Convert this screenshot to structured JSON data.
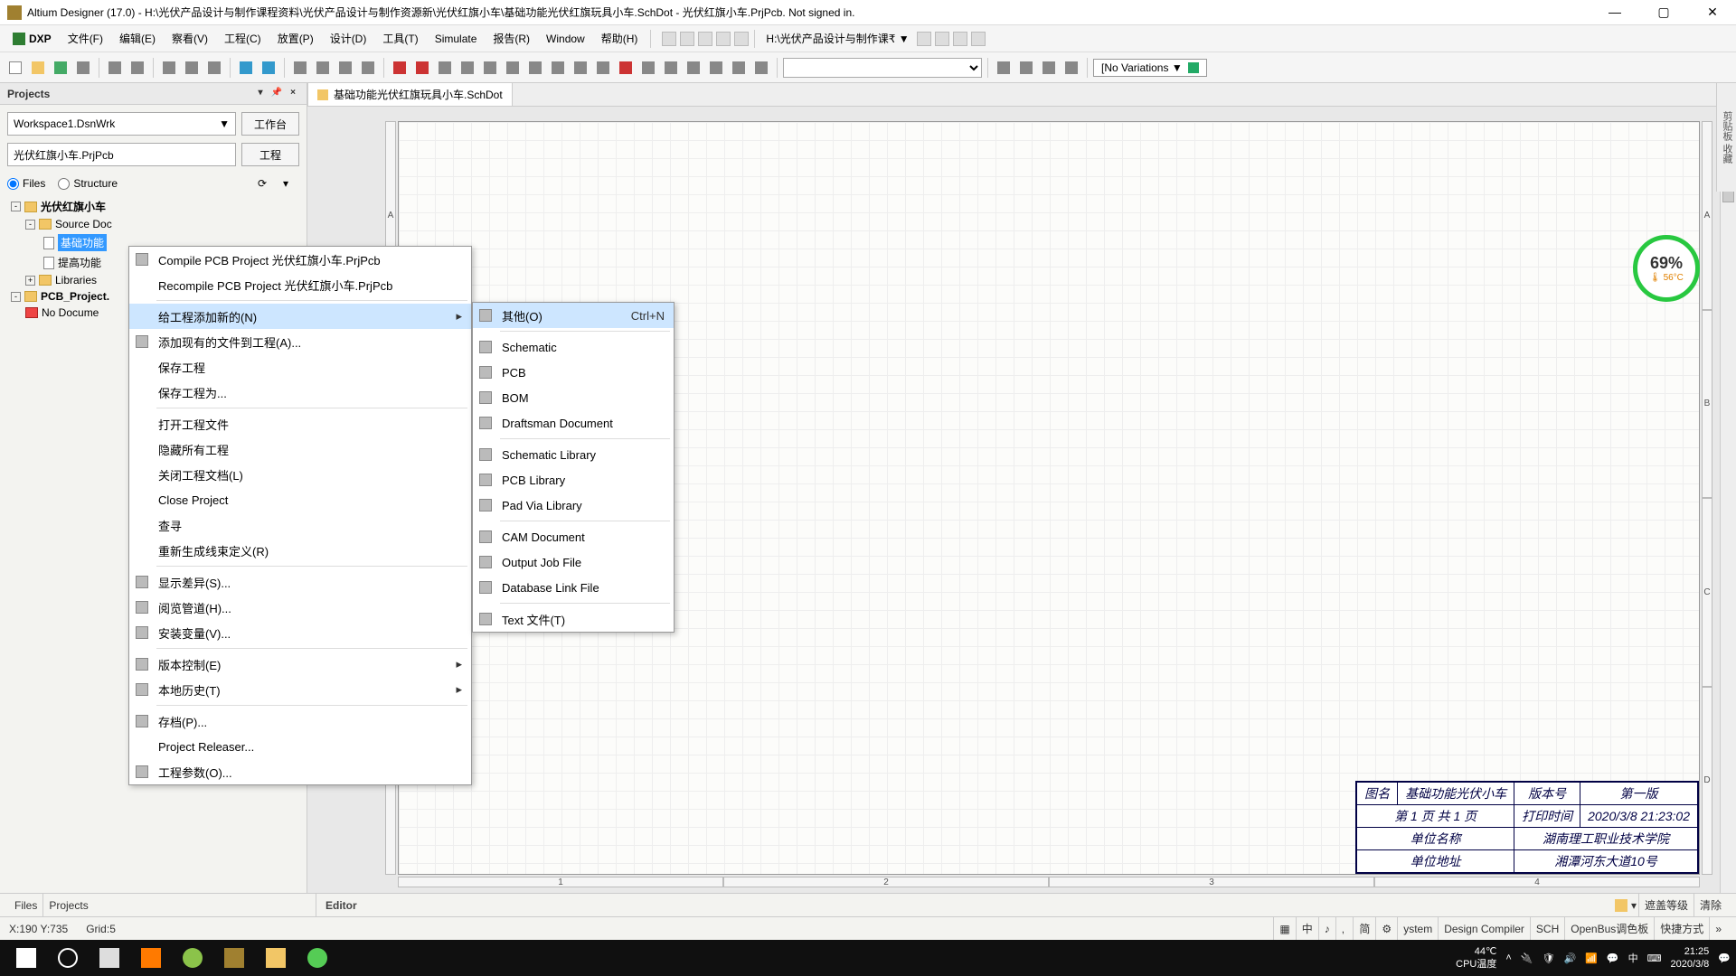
{
  "title": "Altium Designer (17.0) - H:\\光伏产品设计与制作课程资料\\光伏产品设计与制作资源新\\光伏红旗小车\\基础功能光伏红旗玩具小车.SchDot - 光伏红旗小车.PrjPcb. Not signed in.",
  "menubar": {
    "dxp": "DXP",
    "items": [
      "文件(F)",
      "编辑(E)",
      "察看(V)",
      "工程(C)",
      "放置(P)",
      "设计(D)",
      "工具(T)",
      "Simulate",
      "报告(R)",
      "Window",
      "帮助(H)"
    ],
    "path": "H:\\光伏产品设计与制作课₹ ▼"
  },
  "variations": "[No Variations ▼",
  "panel": {
    "title": "Projects",
    "workspace": "Workspace1.DsnWrk",
    "btn_workbench": "工作台",
    "project": "光伏红旗小车.PrjPcb",
    "btn_project": "工程",
    "radio_files": "Files",
    "radio_structure": "Structure"
  },
  "tree": {
    "root": "光伏红旗小车",
    "src": "Source Doc",
    "sel": "基础功能",
    "n2": "提高功能",
    "lib": "Libraries",
    "proj2": "PCB_Project.",
    "nodoc": "No Docume"
  },
  "tab_name": "基础功能光伏红旗玩具小车.SchDot",
  "ruler_top": [
    "1",
    "2",
    "3",
    "4"
  ],
  "ruler_side": [
    "A",
    "B",
    "C",
    "D"
  ],
  "title_block": {
    "r1": [
      "图名",
      "基础功能光伏小车",
      "版本号",
      "第一版"
    ],
    "r2": [
      "第 1 页 共 1 页",
      "打印时间",
      "2020/3/8  21:23:02"
    ],
    "r3": [
      "单位名称",
      "湖南理工职业技术学院"
    ],
    "r4": [
      "单位地址",
      "湘潭河东大道10号"
    ]
  },
  "ctx1": [
    {
      "label": "Compile PCB Project 光伏红旗小车.PrjPcb",
      "icon": true
    },
    {
      "label": "Recompile PCB Project 光伏红旗小车.PrjPcb"
    },
    {
      "sep": true
    },
    {
      "label": "给工程添加新的(N)",
      "arrow": true,
      "hover": true
    },
    {
      "label": "添加现有的文件到工程(A)...",
      "icon": true
    },
    {
      "label": "保存工程"
    },
    {
      "label": "保存工程为..."
    },
    {
      "sep": true
    },
    {
      "label": "打开工程文件"
    },
    {
      "label": "隐藏所有工程"
    },
    {
      "label": "关闭工程文档(L)"
    },
    {
      "label": "Close Project"
    },
    {
      "label": "查寻"
    },
    {
      "label": "重新生成线束定义(R)"
    },
    {
      "sep": true
    },
    {
      "label": "显示差异(S)...",
      "icon": true
    },
    {
      "label": "阅览管道(H)...",
      "icon": true
    },
    {
      "label": "安装变量(V)...",
      "icon": true
    },
    {
      "sep": true
    },
    {
      "label": "版本控制(E)",
      "icon": true,
      "arrow": true
    },
    {
      "label": "本地历史(T)",
      "icon": true,
      "arrow": true
    },
    {
      "sep": true
    },
    {
      "label": "存档(P)...",
      "icon": true
    },
    {
      "label": "Project Releaser..."
    },
    {
      "label": "工程参数(O)...",
      "icon": true
    }
  ],
  "ctx2": [
    {
      "label": "其他(O)",
      "short": "Ctrl+N",
      "icon": true,
      "hover": true
    },
    {
      "sep": true
    },
    {
      "label": "Schematic",
      "icon": true
    },
    {
      "label": "PCB",
      "icon": true
    },
    {
      "label": "BOM",
      "icon": true
    },
    {
      "label": "Draftsman Document",
      "icon": true
    },
    {
      "sep": true
    },
    {
      "label": "Schematic Library",
      "icon": true
    },
    {
      "label": "PCB Library",
      "icon": true
    },
    {
      "label": "Pad Via Library",
      "icon": true
    },
    {
      "sep": true
    },
    {
      "label": "CAM Document",
      "icon": true
    },
    {
      "label": "Output Job File",
      "icon": true
    },
    {
      "label": "Database Link File",
      "icon": true
    },
    {
      "sep": true
    },
    {
      "label": "Text  文件(T)",
      "icon": true
    }
  ],
  "bottom_tabs": [
    "Files",
    "Projects"
  ],
  "editor_label": "Editor",
  "editor_btns": [
    "遮盖等级",
    "清除"
  ],
  "status": {
    "coords": "X:190 Y:735",
    "grid": "Grid:5",
    "right": [
      "ystem",
      "Design Compiler",
      "SCH",
      "OpenBus调色板",
      "快捷方式"
    ]
  },
  "gauge": {
    "pct": "69%",
    "temp": "56°C"
  },
  "side_tab": "剪贴板  收藏",
  "taskbar": {
    "temp": "44℃",
    "temp_label": "CPU温度",
    "time": "21:25",
    "date": "2020/3/8"
  }
}
